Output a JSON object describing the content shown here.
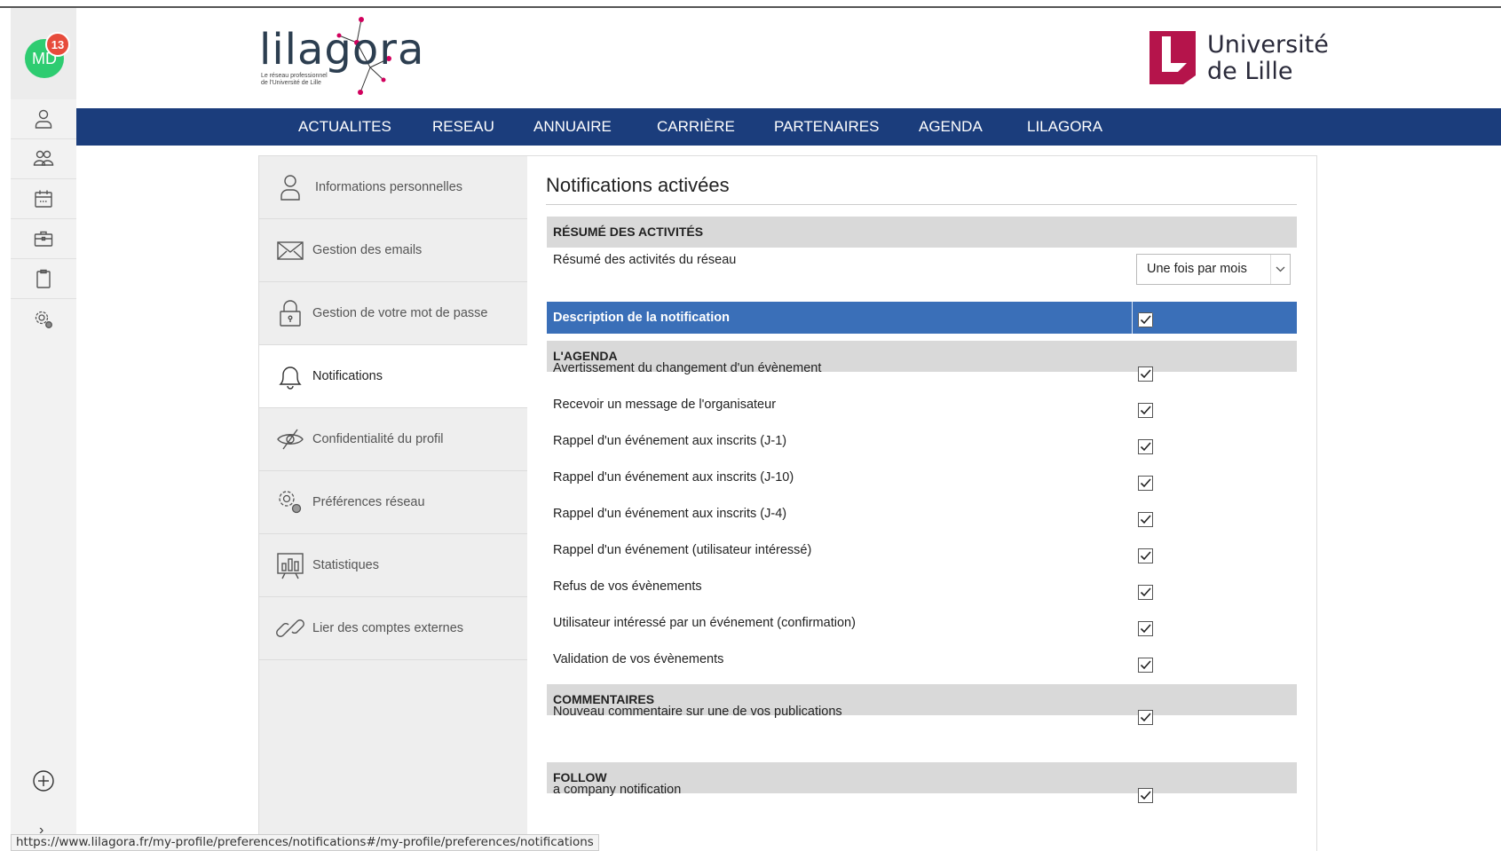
{
  "user": {
    "initials": "MD",
    "notification_count": "13"
  },
  "brand": {
    "logo_text": "lilagora",
    "logo_subtitle_line1": "Le réseau professionnel",
    "logo_subtitle_line2": "de l'Université de Lille",
    "partner_line1": "Université",
    "partner_line2": "de Lille",
    "nav_color": "#1b3d7c",
    "accent_color": "#3a6fb8",
    "badge_color": "#e74c3c",
    "avatar_color": "#2ecc71"
  },
  "rail": {
    "icons": [
      "user-icon",
      "group-icon",
      "calendar-icon",
      "briefcase-icon",
      "clipboard-icon",
      "settings-icon",
      "plus-circle-icon",
      "chevron-right-icon"
    ],
    "chevron": "›"
  },
  "nav": {
    "items": [
      "ACTUALITES",
      "RESEAU",
      "ANNUAIRE",
      "CARRIÈRE",
      "PARTENAIRES",
      "AGENDA",
      "LILAGORA"
    ]
  },
  "sidebar": {
    "items": [
      {
        "label": "Informations personnelles",
        "icon": "user-icon"
      },
      {
        "label": "Gestion des emails",
        "icon": "envelope-icon"
      },
      {
        "label": "Gestion de votre mot de passe",
        "icon": "lock-icon"
      },
      {
        "label": "Notifications",
        "icon": "bell-icon",
        "active": true
      },
      {
        "label": "Confidentialité du profil",
        "icon": "eye-slash-icon"
      },
      {
        "label": "Préférences réseau",
        "icon": "settings-icon"
      },
      {
        "label": "Statistiques",
        "icon": "chart-icon"
      },
      {
        "label": "Lier des comptes externes",
        "icon": "link-icon"
      }
    ]
  },
  "content": {
    "title": "Notifications activées",
    "summary": {
      "heading": "RÉSUMÉ DES ACTIVITÉS",
      "row_label": "Résumé des activités du réseau",
      "select_value": "Une fois par mois"
    },
    "description_bar": {
      "label": "Description de la notification",
      "checked": true
    },
    "agenda": {
      "heading": "L'AGENDA",
      "rows": [
        "Avertissement du changement d'un évènement",
        "Recevoir un message de l'organisateur",
        "Rappel d'un événement aux inscrits (J-1)",
        "Rappel d'un événement aux inscrits (J-10)",
        "Rappel d'un événement aux inscrits (J-4)",
        "Rappel d'un événement (utilisateur intéressé)",
        "Refus de vos évènements",
        "Utilisateur intéressé par un événement (confirmation)",
        "Validation de vos évènements"
      ]
    },
    "comments": {
      "heading": "COMMENTAIRES",
      "rows": [
        "Nouveau commentaire sur une de vos publications"
      ]
    },
    "follow": {
      "heading": "FOLLOW",
      "rows": [
        "a company notification"
      ]
    }
  },
  "statusbar": {
    "url": "https://www.lilagora.fr/my-profile/preferences/notifications#/my-profile/preferences/notifications"
  }
}
